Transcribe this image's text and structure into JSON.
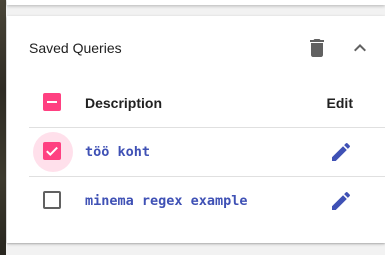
{
  "panel": {
    "title": "Saved Queries",
    "delete_icon": "delete-icon",
    "collapse_icon": "chevron-up-icon"
  },
  "table": {
    "columns": {
      "description": "Description",
      "edit": "Edit"
    },
    "select_all_state": "indeterminate",
    "rows": [
      {
        "name": "töö koht",
        "checked": true,
        "edit_icon": "pencil-icon"
      },
      {
        "name": "minema regex example",
        "checked": false,
        "edit_icon": "pencil-icon"
      }
    ]
  },
  "colors": {
    "accent": "#ff4081",
    "link": "#3f51b5",
    "icon": "#616161",
    "divider": "#e0e0e0"
  }
}
